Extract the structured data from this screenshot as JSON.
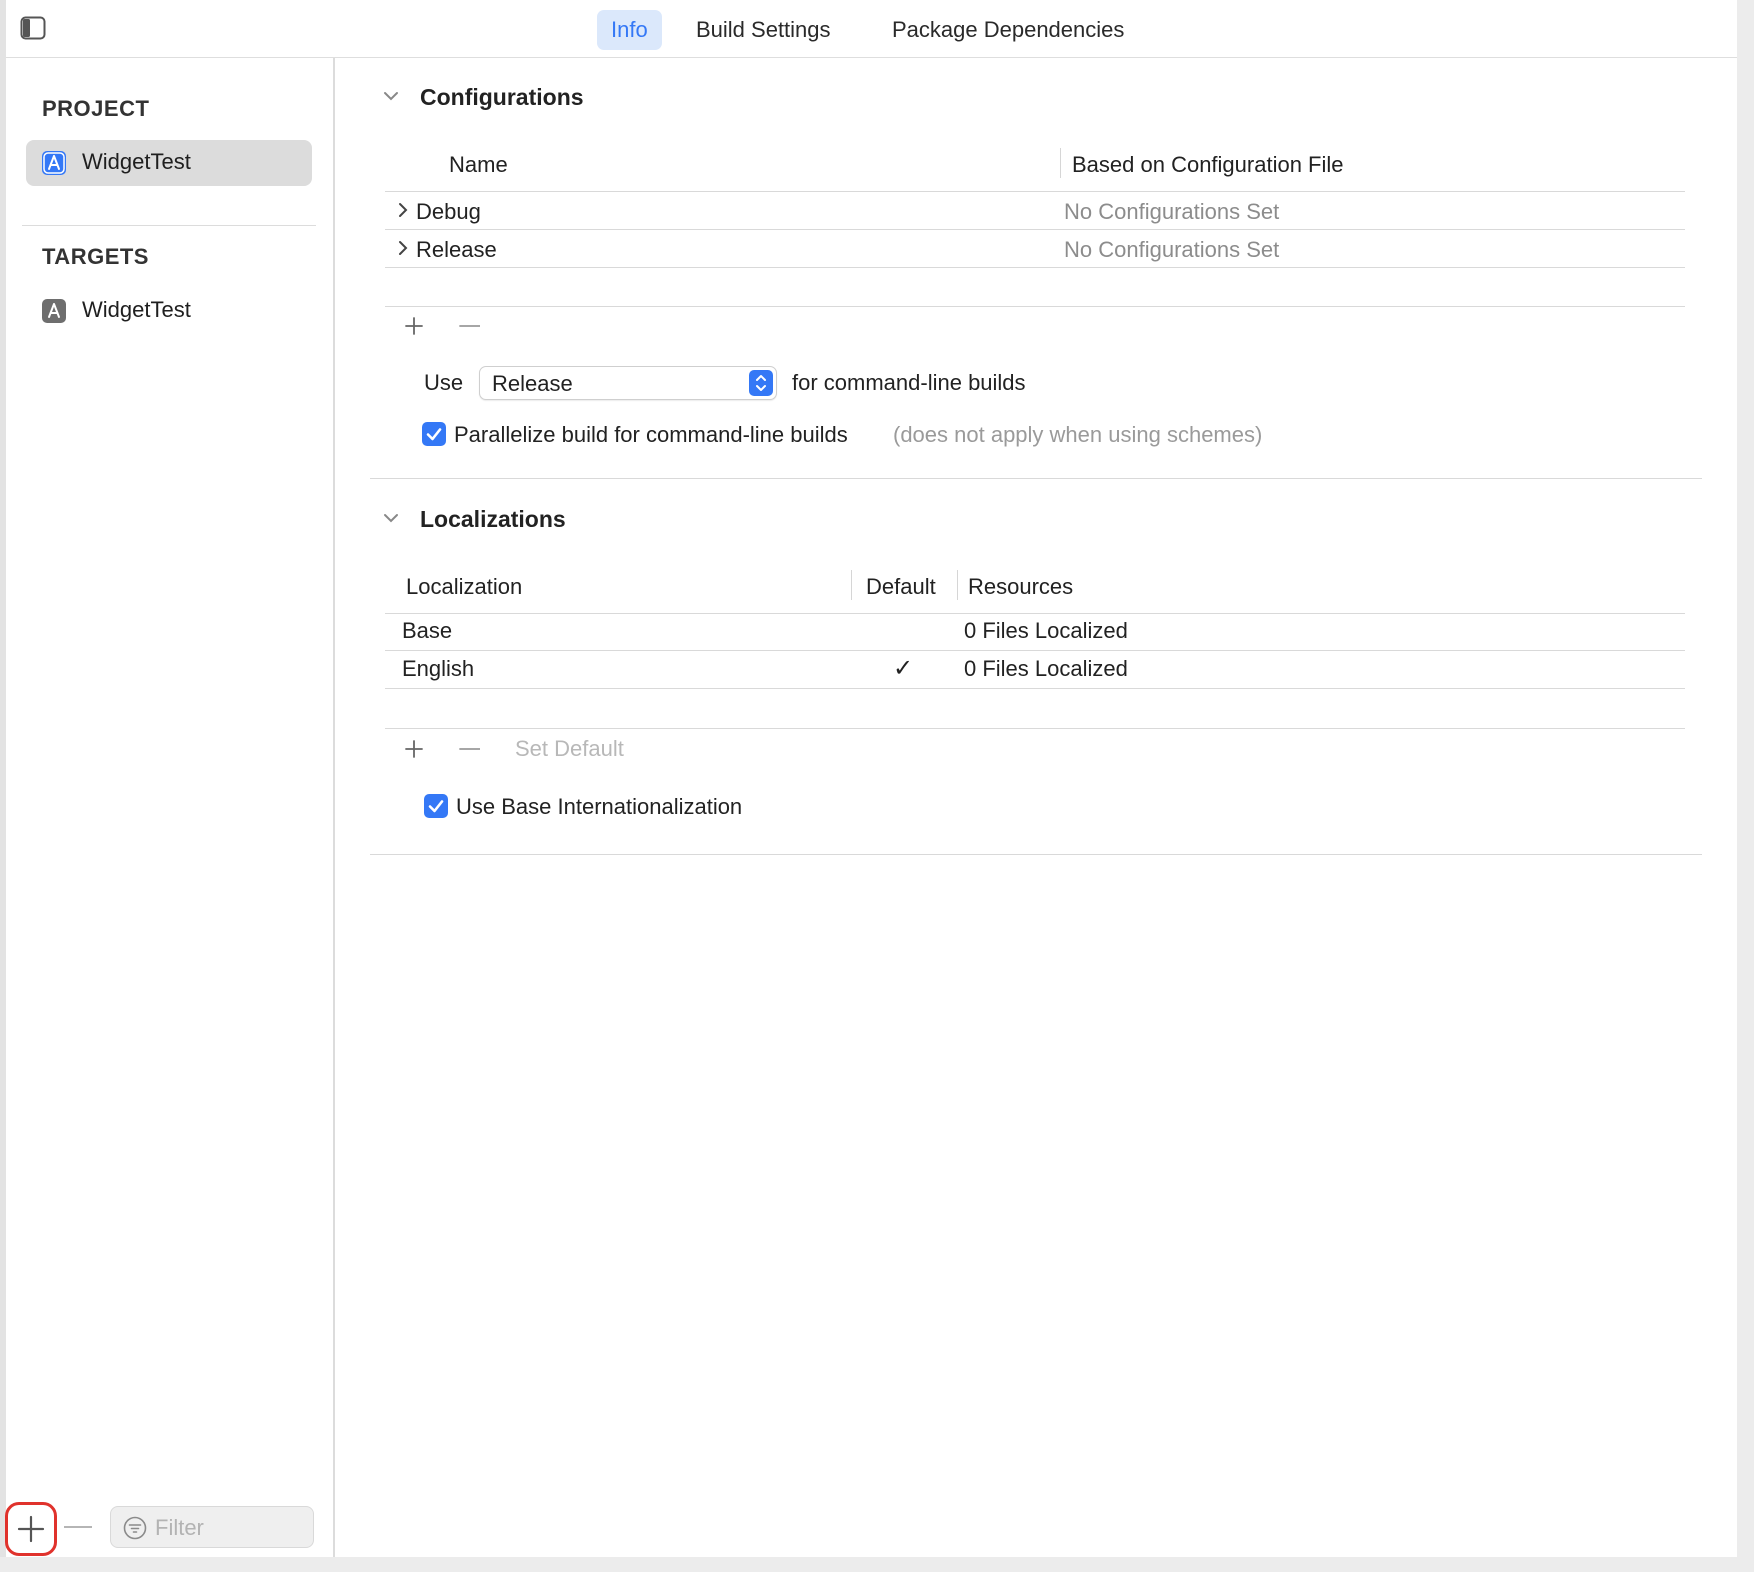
{
  "toolbar": {
    "tabs": [
      {
        "label": "Info",
        "active": true
      },
      {
        "label": "Build Settings",
        "active": false
      },
      {
        "label": "Package Dependencies",
        "active": false
      }
    ]
  },
  "sidebar": {
    "project_header": "PROJECT",
    "project_items": [
      {
        "label": "WidgetTest",
        "icon": "app-project-icon",
        "selected": true
      }
    ],
    "targets_header": "TARGETS",
    "target_items": [
      {
        "label": "WidgetTest",
        "icon": "app-target-icon",
        "selected": false
      }
    ],
    "filter_placeholder": "Filter"
  },
  "configurations": {
    "title": "Configurations",
    "columns": [
      "Name",
      "Based on Configuration File"
    ],
    "rows": [
      {
        "name": "Debug",
        "file": "No Configurations Set"
      },
      {
        "name": "Release",
        "file": "No Configurations Set"
      }
    ],
    "use_label": "Use",
    "use_value": "Release",
    "use_suffix": "for command-line builds",
    "parallelize_label": "Parallelize build for command-line builds",
    "parallelize_note": "(does not apply when using schemes)",
    "parallelize_checked": true
  },
  "localizations": {
    "title": "Localizations",
    "columns": [
      "Localization",
      "Default",
      "Resources"
    ],
    "rows": [
      {
        "localization": "Base",
        "default": "",
        "resources": "0 Files Localized"
      },
      {
        "localization": "English",
        "default": "✓",
        "resources": "0 Files Localized"
      }
    ],
    "set_default_label": "Set Default",
    "base_intl_label": "Use Base Internationalization",
    "base_intl_checked": true
  },
  "colors": {
    "accent": "#3478f6",
    "active_tab_bg": "#dbe8fb",
    "highlight_ring": "#e0322c"
  }
}
